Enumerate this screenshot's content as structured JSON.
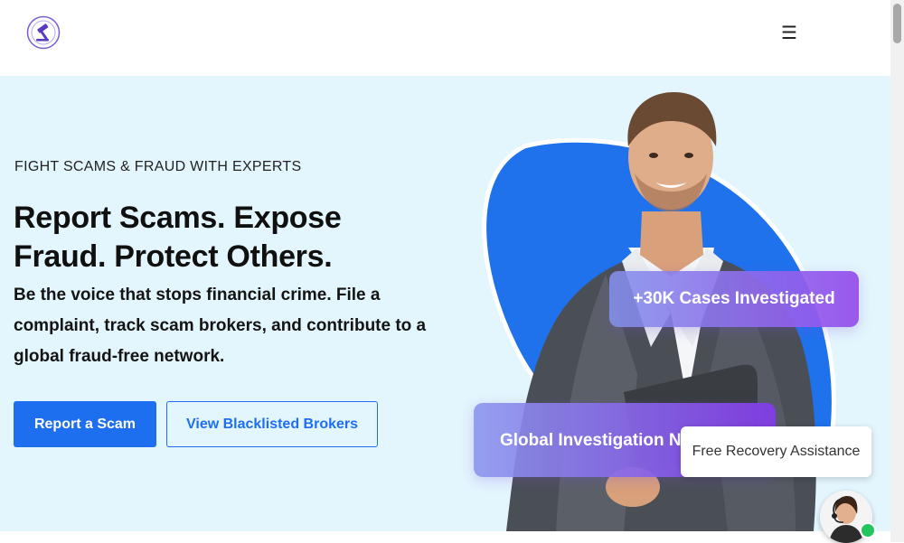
{
  "header": {
    "logo_icon": "gavel-seal-icon",
    "menu_icon": "hamburger-menu-icon",
    "menu_glyph": "☰"
  },
  "hero": {
    "eyebrow": "FIGHT SCAMS & FRAUD WITH EXPERTS",
    "headline": "Report Scams. Expose Fraud. Protect Others.",
    "lede": "Be the voice that stops financial crime. File a complaint, track scam brokers, and contribute to a global fraud-free network.",
    "primary_cta": "Report a Scam",
    "secondary_cta": "View Blacklisted Brokers",
    "badge_cases": "+30K Cases Investigated",
    "badge_global": "Global Investigation Network"
  },
  "chat": {
    "label": "Free Recovery Assistance",
    "status": "online"
  },
  "colors": {
    "accent": "#1e6ff0",
    "hero_bg": "#e3f5fd",
    "blob": "#1f72ec",
    "badge_start": "#8c96ec",
    "badge_end": "#8240e6",
    "online": "#22c55e"
  }
}
